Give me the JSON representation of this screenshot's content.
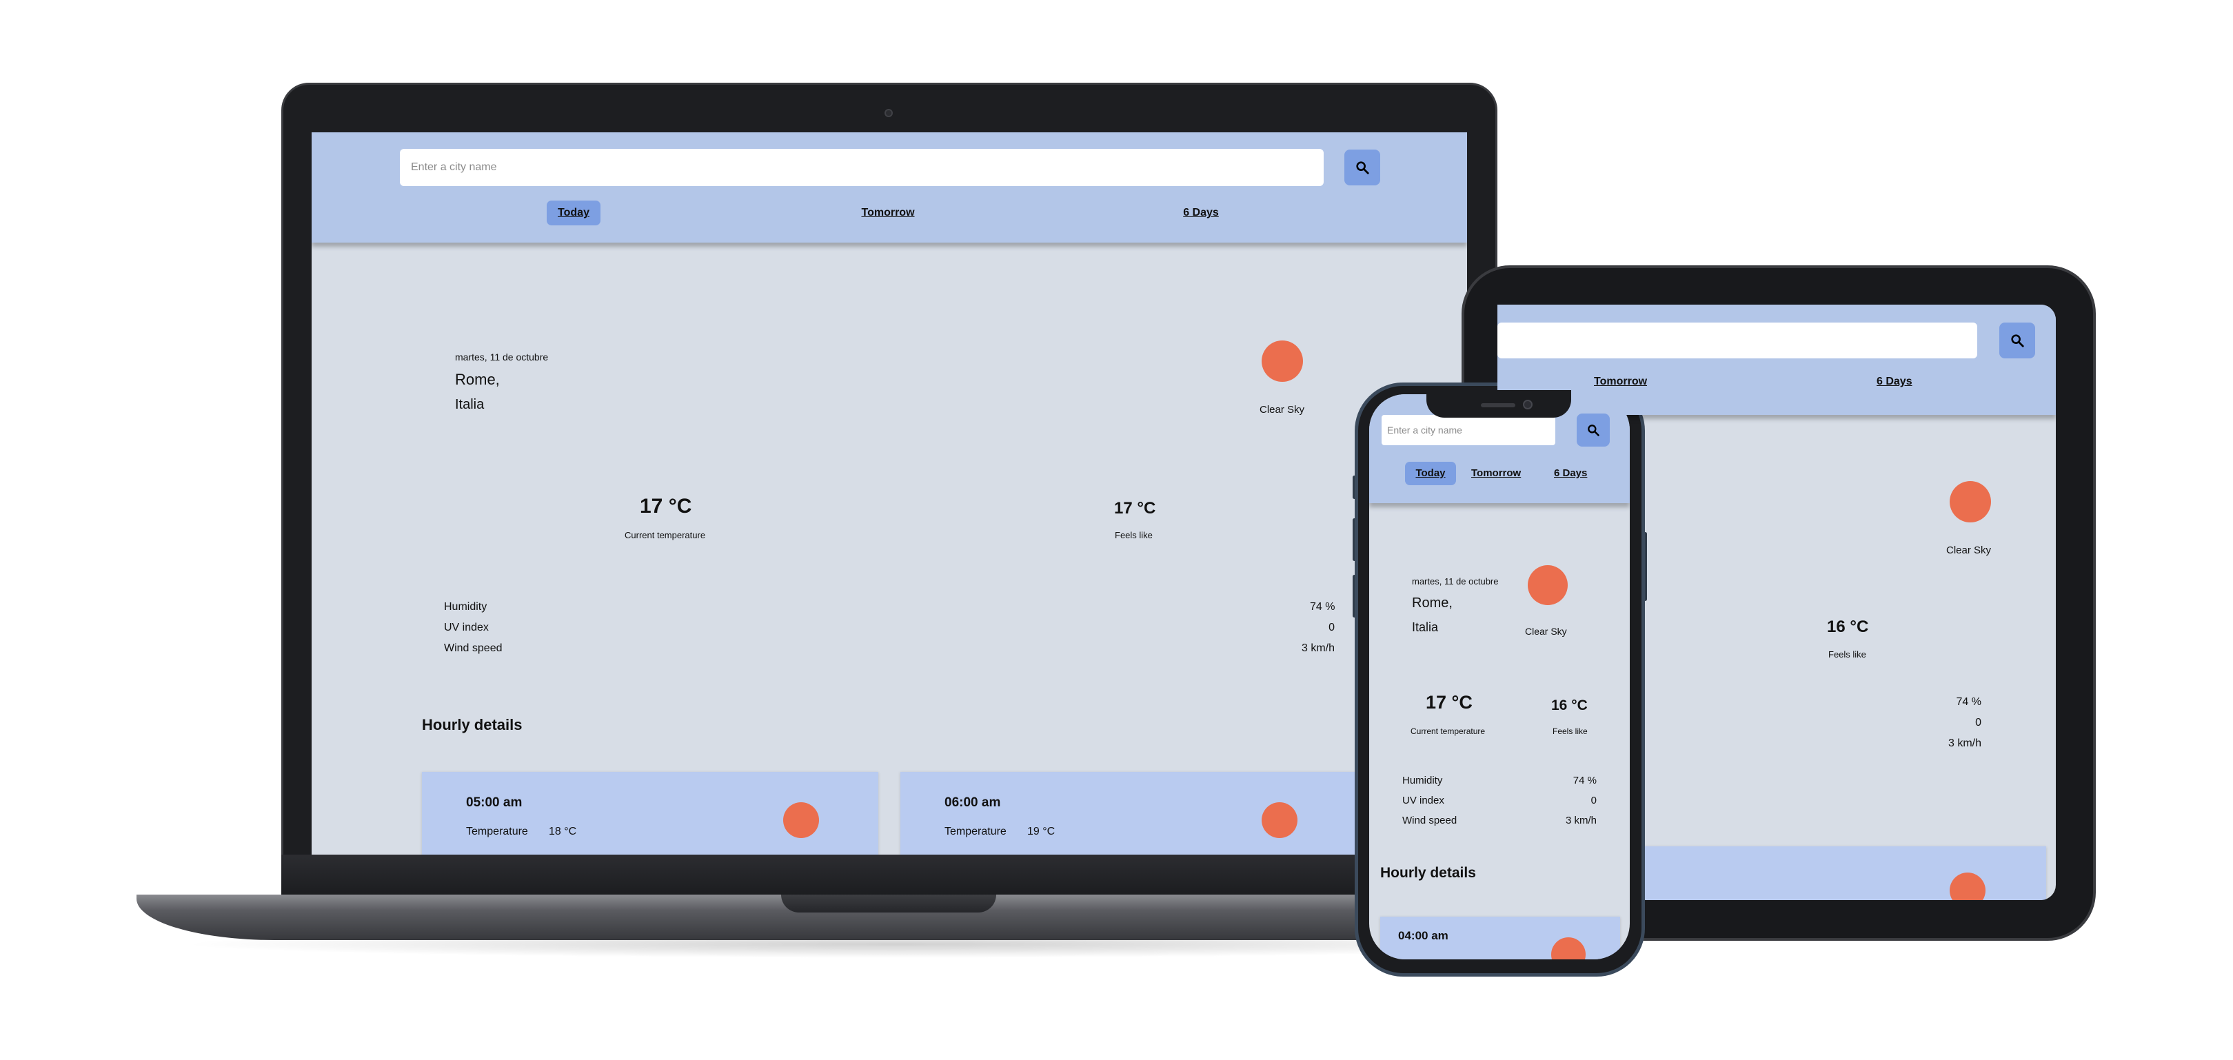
{
  "app": {
    "search_placeholder": "Enter a city name",
    "tabs": [
      "Today",
      "Tomorrow",
      "6 Days"
    ],
    "active_tab": "Today"
  },
  "laptop": {
    "date": "martes, 11 de octubre",
    "city": "Rome,",
    "country": "Italia",
    "condition": "Clear Sky",
    "current_temp": "17 °C",
    "current_temp_label": "Current temperature",
    "feels_like": "17 °C",
    "feels_like_label": "Feels like",
    "details": [
      {
        "label": "Humidity",
        "value": "74 %"
      },
      {
        "label": "UV index",
        "value": "0"
      },
      {
        "label": "Wind speed",
        "value": "3 km/h"
      }
    ],
    "hourly_title": "Hourly details",
    "hourly": [
      {
        "time": "05:00 am",
        "temp_label": "Temperature",
        "temp": "18 °C"
      },
      {
        "time": "06:00 am",
        "temp_label": "Temperature",
        "temp": "19 °C"
      }
    ]
  },
  "tablet": {
    "tab_partial": "Tomorrow",
    "tab_days": "6 Days",
    "condition": "Clear Sky",
    "feels_like": "16 °C",
    "feels_like_label": "Feels like",
    "details_values": [
      "74 %",
      "0",
      "3 km/h"
    ]
  },
  "phone": {
    "date": "martes, 11 de octubre",
    "city": "Rome,",
    "country": "Italia",
    "condition": "Clear Sky",
    "current_temp": "17 °C",
    "current_temp_label": "Current temperature",
    "feels_like": "16 °C",
    "feels_like_label": "Feels like",
    "details": [
      {
        "label": "Humidity",
        "value": "74 %"
      },
      {
        "label": "UV index",
        "value": "0"
      },
      {
        "label": "Wind speed",
        "value": "3 km/h"
      }
    ],
    "hourly_title": "Hourly details",
    "hourly": [
      {
        "time": "04:00 am"
      }
    ]
  },
  "colors": {
    "header_bg": "#b3c6e8",
    "page_bg": "#d7dde6",
    "accent": "#7d9fe2",
    "sun": "#eb6e4e",
    "card_bg": "#b9cbf0"
  },
  "icons": {
    "search": "search-icon",
    "weather": "sun-icon"
  }
}
